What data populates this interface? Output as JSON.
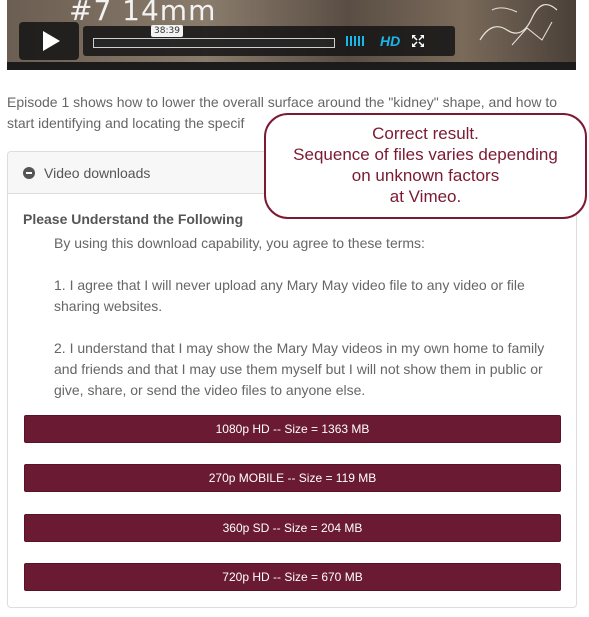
{
  "video": {
    "title_overlay": "#7 14mm",
    "time": "38:39",
    "hd_label": "HD",
    "icons": [
      "play-icon",
      "volume-icon",
      "fullscreen-icon"
    ],
    "accent_color": "#1ab7ea"
  },
  "intro": {
    "text": "Episode 1 shows how to lower the overall surface around the \"kidney\" shape, and how to start identifying and locating the specif"
  },
  "downloads": {
    "header_label": "Video downloads",
    "terms_heading": "Please Understand the Following",
    "terms_intro": "By using this download capability, you agree to these terms:",
    "term_1": "1. I agree that I will never upload any Mary May video file to any video or file sharing websites.",
    "term_2": "2. I understand that I may show the Mary May videos in my own home to family and friends and that I may use them myself but I will not show them in public or give, share, or send the video files to anyone else.",
    "buttons": [
      {
        "label": "1080p HD -- Size = 1363 MB"
      },
      {
        "label": "270p MOBILE -- Size = 119 MB"
      },
      {
        "label": "360p SD -- Size = 204 MB"
      },
      {
        "label": "720p HD -- Size = 670 MB"
      }
    ],
    "button_color": "#6b1a33"
  },
  "callout": {
    "line_1": "Correct result.",
    "line_2": "Sequence of files varies depending",
    "line_3": "on unknown factors",
    "line_4": "at Vimeo.",
    "border_color": "#7a1a33"
  }
}
